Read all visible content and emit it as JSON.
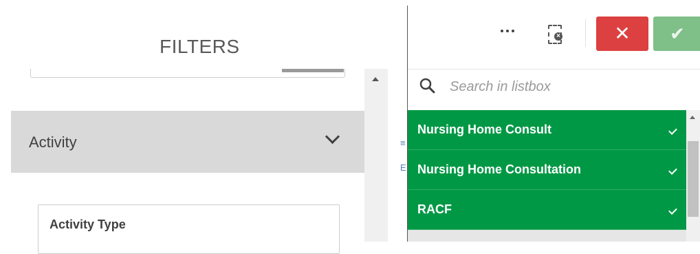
{
  "filters_panel": {
    "title": "FILTERS",
    "activity_section": {
      "label": "Activity",
      "expanded": true
    },
    "activity_type": {
      "label": "Activity Type"
    }
  },
  "listbox": {
    "toolbar": {
      "more_icon": "ellipsis-icon",
      "clear_icon": "clear-selection-icon",
      "cancel_glyph": "✕",
      "confirm_glyph": "✔"
    },
    "search": {
      "placeholder": "Search in listbox",
      "value": ""
    },
    "items": [
      {
        "label": "Nursing Home Consult",
        "selected": true
      },
      {
        "label": "Nursing Home Consultation",
        "selected": true
      },
      {
        "label": "RACF",
        "selected": true
      }
    ]
  },
  "colors": {
    "selected_green": "#009845",
    "cancel_red": "#dc4040",
    "confirm_green": "#7fbf88",
    "section_gray": "#d9d9d9"
  }
}
